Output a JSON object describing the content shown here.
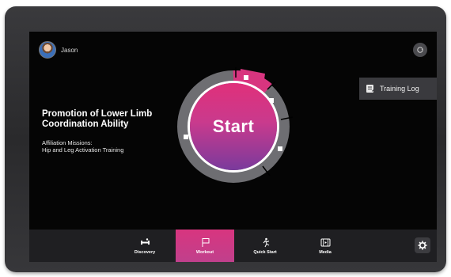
{
  "user": {
    "name": "Jason"
  },
  "course": {
    "title": "Promotion of Lower Limb Coordination Ability",
    "missions_label": "Affiliation Missions:",
    "missions_name": "Hip and Leg Activation Training"
  },
  "start": {
    "label": "Start"
  },
  "training_log": {
    "label": "Training Log"
  },
  "nav": {
    "items": [
      {
        "label": "Discovery",
        "icon": "dumbbell-icon"
      },
      {
        "label": "Workout",
        "icon": "flag-icon"
      },
      {
        "label": "Quick Start",
        "icon": "runner-icon"
      },
      {
        "label": "Media",
        "icon": "film-icon"
      }
    ],
    "active": "Workout"
  },
  "colors": {
    "accent": "#d8357f",
    "ring": "#6e6e72",
    "background": "#050505"
  }
}
